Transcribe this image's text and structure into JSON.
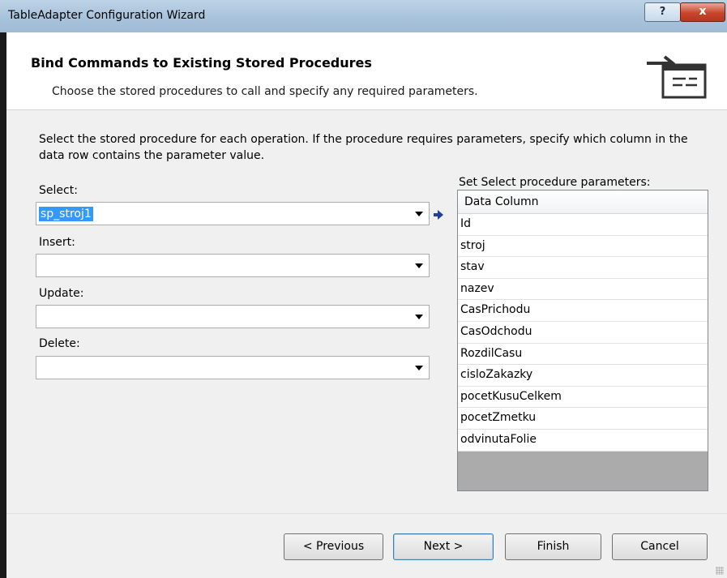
{
  "window": {
    "title": "TableAdapter Configuration Wizard",
    "help_label": "?",
    "close_label": "x"
  },
  "header": {
    "title": "Bind Commands to Existing Stored Procedures",
    "subtitle": "Choose the stored procedures to call and specify any required parameters.",
    "icon": "stored-procedure-arrow-icon"
  },
  "body": {
    "instructions": "Select the stored procedure for each operation. If the procedure requires parameters, specify which column in the data row contains the parameter value.",
    "select": {
      "label": "Select:",
      "value": "sp_stroj1"
    },
    "insert": {
      "label": "Insert:",
      "value": ""
    },
    "update": {
      "label": "Update:",
      "value": ""
    },
    "delete": {
      "label": "Delete:",
      "value": ""
    },
    "params": {
      "label": "Set Select procedure parameters:",
      "column_header": "Data Column",
      "rows": [
        "Id",
        "stroj",
        "stav",
        "nazev",
        "CasPrichodu",
        "CasOdchodu",
        "RozdilCasu",
        "cisloZakazky",
        "pocetKusuCelkem",
        "pocetZmetku",
        "odvinutaFolie"
      ]
    }
  },
  "footer": {
    "previous_label": "< Previous",
    "next_label": "Next >",
    "finish_label": "Finish",
    "cancel_label": "Cancel"
  },
  "colors": {
    "selection": "#3399ff",
    "arrow": "#1f3f9e",
    "close_button": "#c8452b"
  }
}
